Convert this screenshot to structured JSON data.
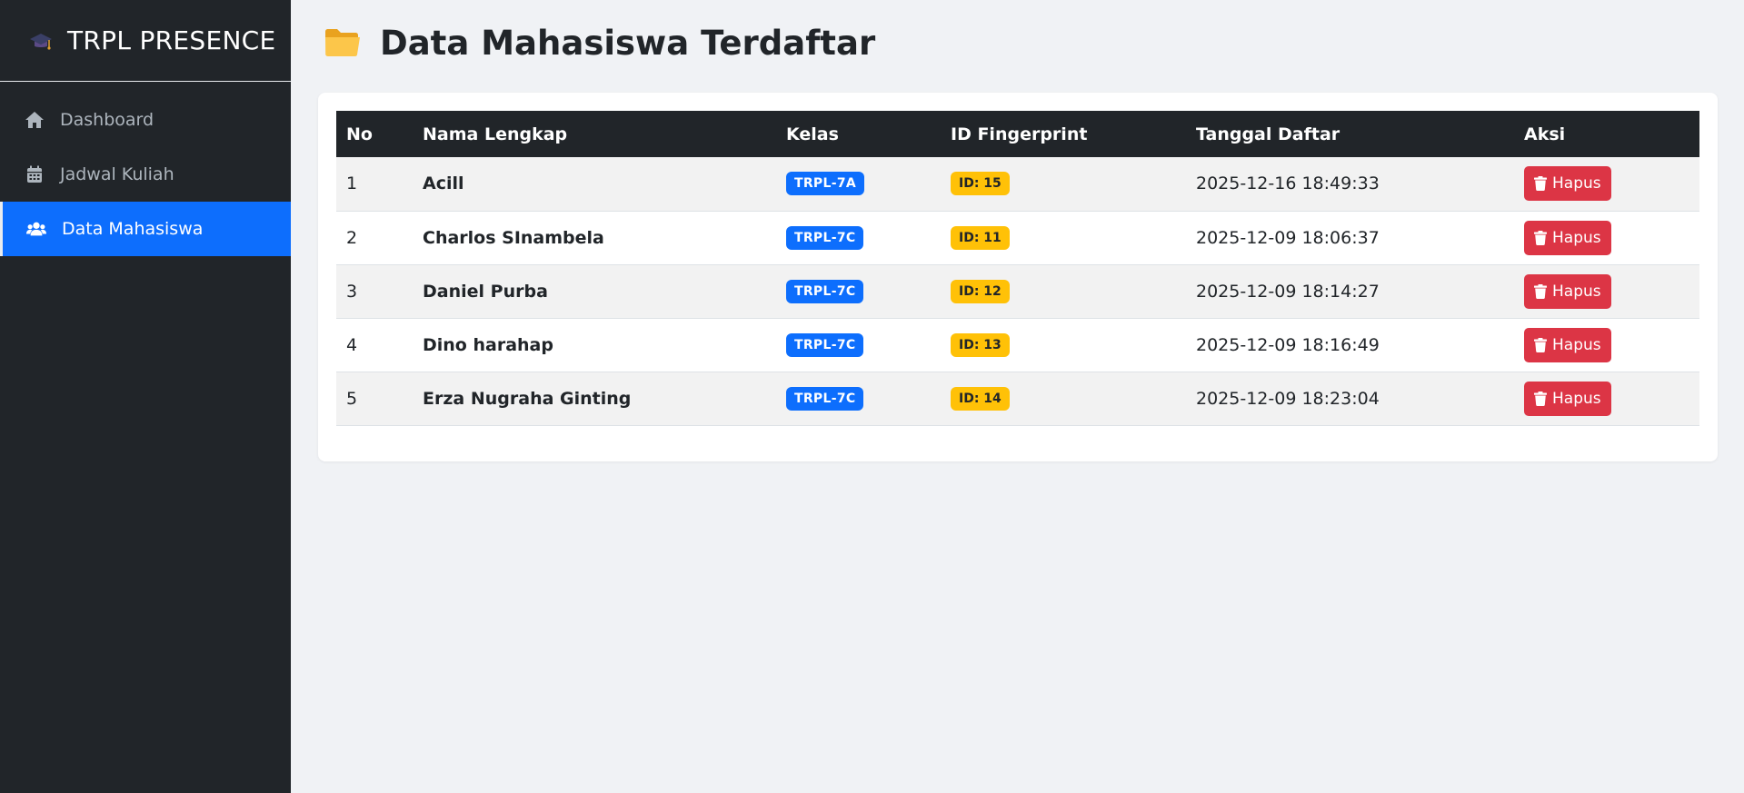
{
  "sidebar": {
    "brand": "TRPL PRESENCE",
    "items": [
      {
        "label": "Dashboard",
        "icon": "home-icon",
        "active": false
      },
      {
        "label": "Jadwal Kuliah",
        "icon": "calendar-icon",
        "active": false
      },
      {
        "label": "Data Mahasiswa",
        "icon": "users-icon",
        "active": true
      }
    ]
  },
  "main": {
    "title": "Data Mahasiswa Terdaftar",
    "table": {
      "headers": [
        "No",
        "Nama Lengkap",
        "Kelas",
        "ID Fingerprint",
        "Tanggal Daftar",
        "Aksi"
      ],
      "rows": [
        {
          "no": "1",
          "nama": "Acill",
          "kelas": "TRPL-7A",
          "fp": "ID: 15",
          "tanggal": "2025-12-16 18:49:33",
          "aksi": "Hapus"
        },
        {
          "no": "2",
          "nama": "Charlos SInambela",
          "kelas": "TRPL-7C",
          "fp": "ID: 11",
          "tanggal": "2025-12-09 18:06:37",
          "aksi": "Hapus"
        },
        {
          "no": "3",
          "nama": "Daniel Purba",
          "kelas": "TRPL-7C",
          "fp": "ID: 12",
          "tanggal": "2025-12-09 18:14:27",
          "aksi": "Hapus"
        },
        {
          "no": "4",
          "nama": "Dino harahap",
          "kelas": "TRPL-7C",
          "fp": "ID: 13",
          "tanggal": "2025-12-09 18:16:49",
          "aksi": "Hapus"
        },
        {
          "no": "5",
          "nama": "Erza Nugraha Ginting",
          "kelas": "TRPL-7C",
          "fp": "ID: 14",
          "tanggal": "2025-12-09 18:23:04",
          "aksi": "Hapus"
        }
      ]
    }
  },
  "colors": {
    "sidebar_bg": "#212529",
    "active": "#0d6efd",
    "danger": "#dc3545",
    "warning": "#ffc107",
    "page_bg": "#f0f2f5"
  }
}
